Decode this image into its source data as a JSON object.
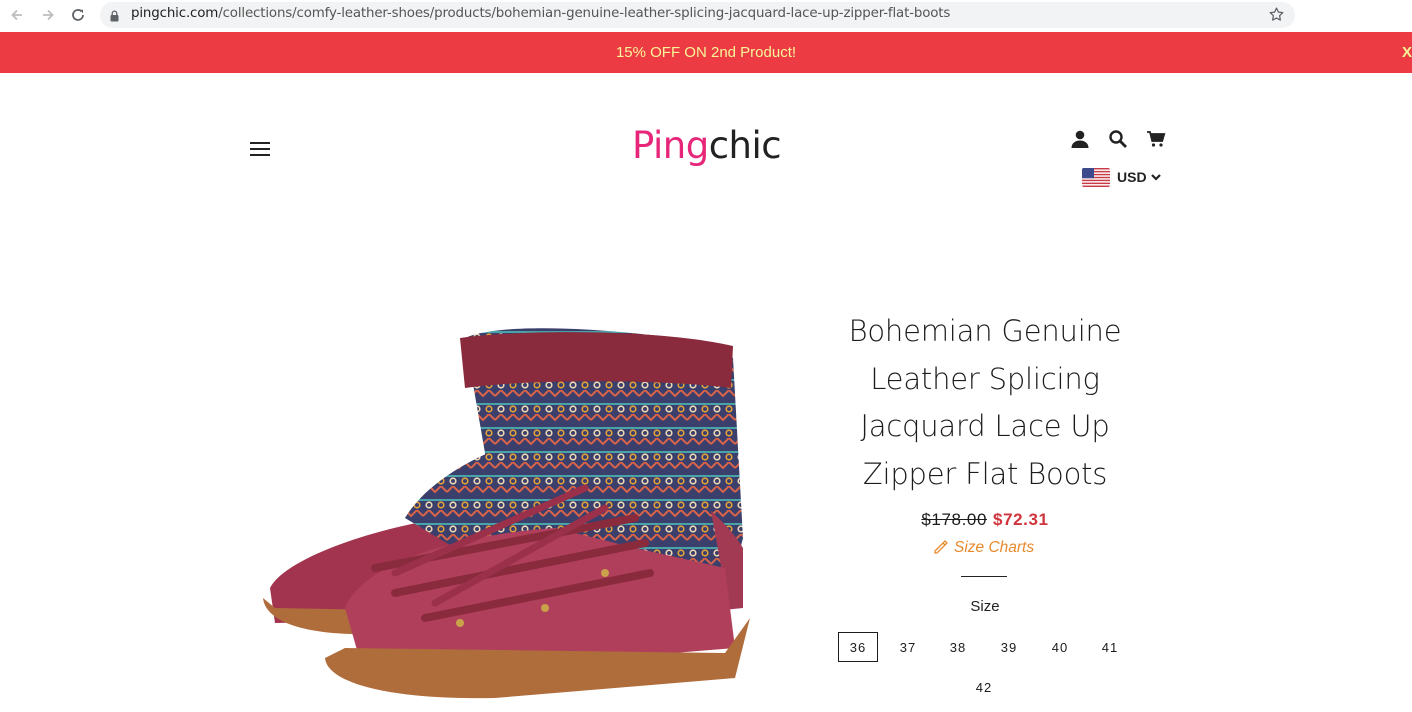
{
  "browser": {
    "url_host": "pingchic.com",
    "url_path": "/collections/comfy-leather-shoes/products/bohemian-genuine-leather-splicing-jacquard-lace-up-zipper-flat-boots"
  },
  "promo": {
    "text": "15% OFF ON 2nd Product!",
    "close_label": "X"
  },
  "header": {
    "logo_ping": "Ping",
    "logo_chic": "chic",
    "currency": "USD"
  },
  "product": {
    "title": "Bohemian Genuine Leather Splicing Jacquard Lace Up Zipper Flat Boots",
    "compare_price": "$178.00",
    "price": "$72.31",
    "size_chart_label": "Size Charts",
    "size_label": "Size",
    "sizes": [
      "36",
      "37",
      "38",
      "39",
      "40",
      "41",
      "42"
    ],
    "selected_size": "36"
  },
  "colors": {
    "promo_bg": "#ec3b43",
    "promo_text": "#f6f59a",
    "logo_pink": "#e7267a",
    "sale_price": "#d0343c",
    "size_chart": "#e68a2e"
  },
  "icons": [
    "back-arrow-icon",
    "forward-arrow-icon",
    "reload-icon",
    "lock-icon",
    "bookmark-star-icon",
    "menu-icon",
    "account-icon",
    "search-icon",
    "cart-icon",
    "us-flag-icon",
    "chevron-down-icon",
    "ruler-pencil-icon"
  ]
}
